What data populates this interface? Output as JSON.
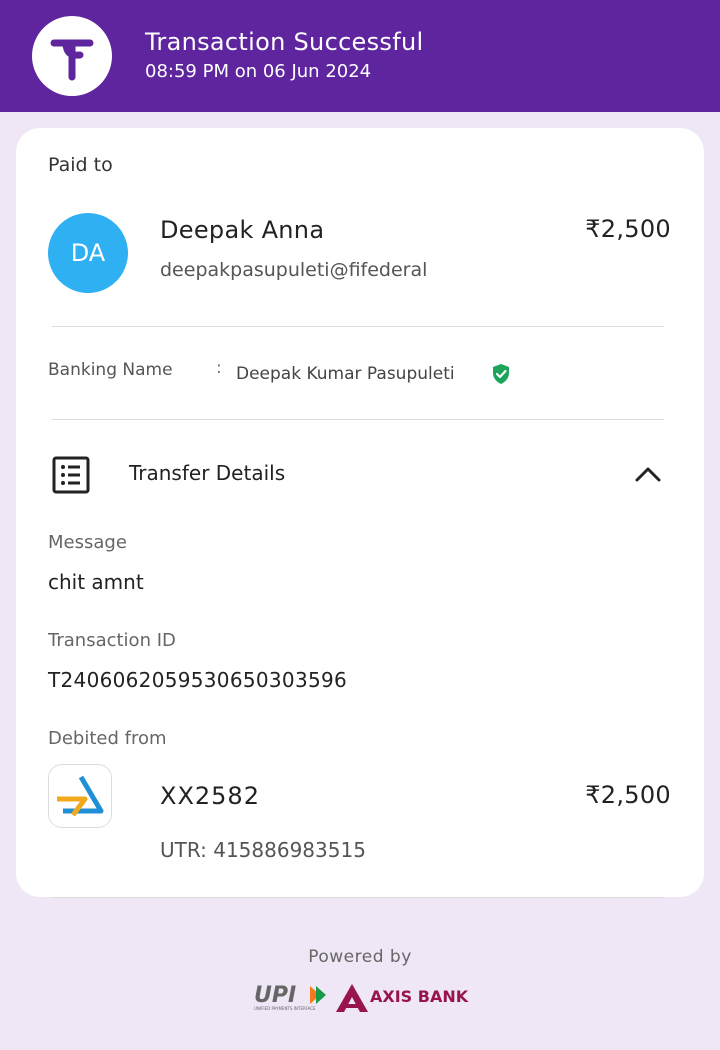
{
  "header": {
    "title": "Transaction Successful",
    "datetime": "08:59 PM on 06 Jun 2024",
    "colors": {
      "brand": "#5f259f"
    }
  },
  "paid_to": {
    "label": "Paid to",
    "avatar_initials": "DA",
    "name": "Deepak Anna",
    "vpa": "deepakpasupuleti@fifederal",
    "amount": "₹2,500"
  },
  "banking": {
    "label": "Banking Name",
    "colon": ":",
    "name": "Deepak Kumar Pasupuleti",
    "verified_icon": "verified-shield-icon"
  },
  "transfer": {
    "title": "Transfer Details",
    "expanded": true,
    "message_label": "Message",
    "message": "chit amnt",
    "txn_id_label": "Transaction ID",
    "txn_id": "T2406062059530650303596",
    "debited_label": "Debited from",
    "account": "XX2582",
    "amount": "₹2,500",
    "utr": "UTR: 415886983515"
  },
  "footer": {
    "powered_by": "Powered by",
    "upi_text": "UPI",
    "upi_subtext": "UNIFIED PAYMENTS INTERFACE",
    "bank_text": "AXIS BANK"
  }
}
